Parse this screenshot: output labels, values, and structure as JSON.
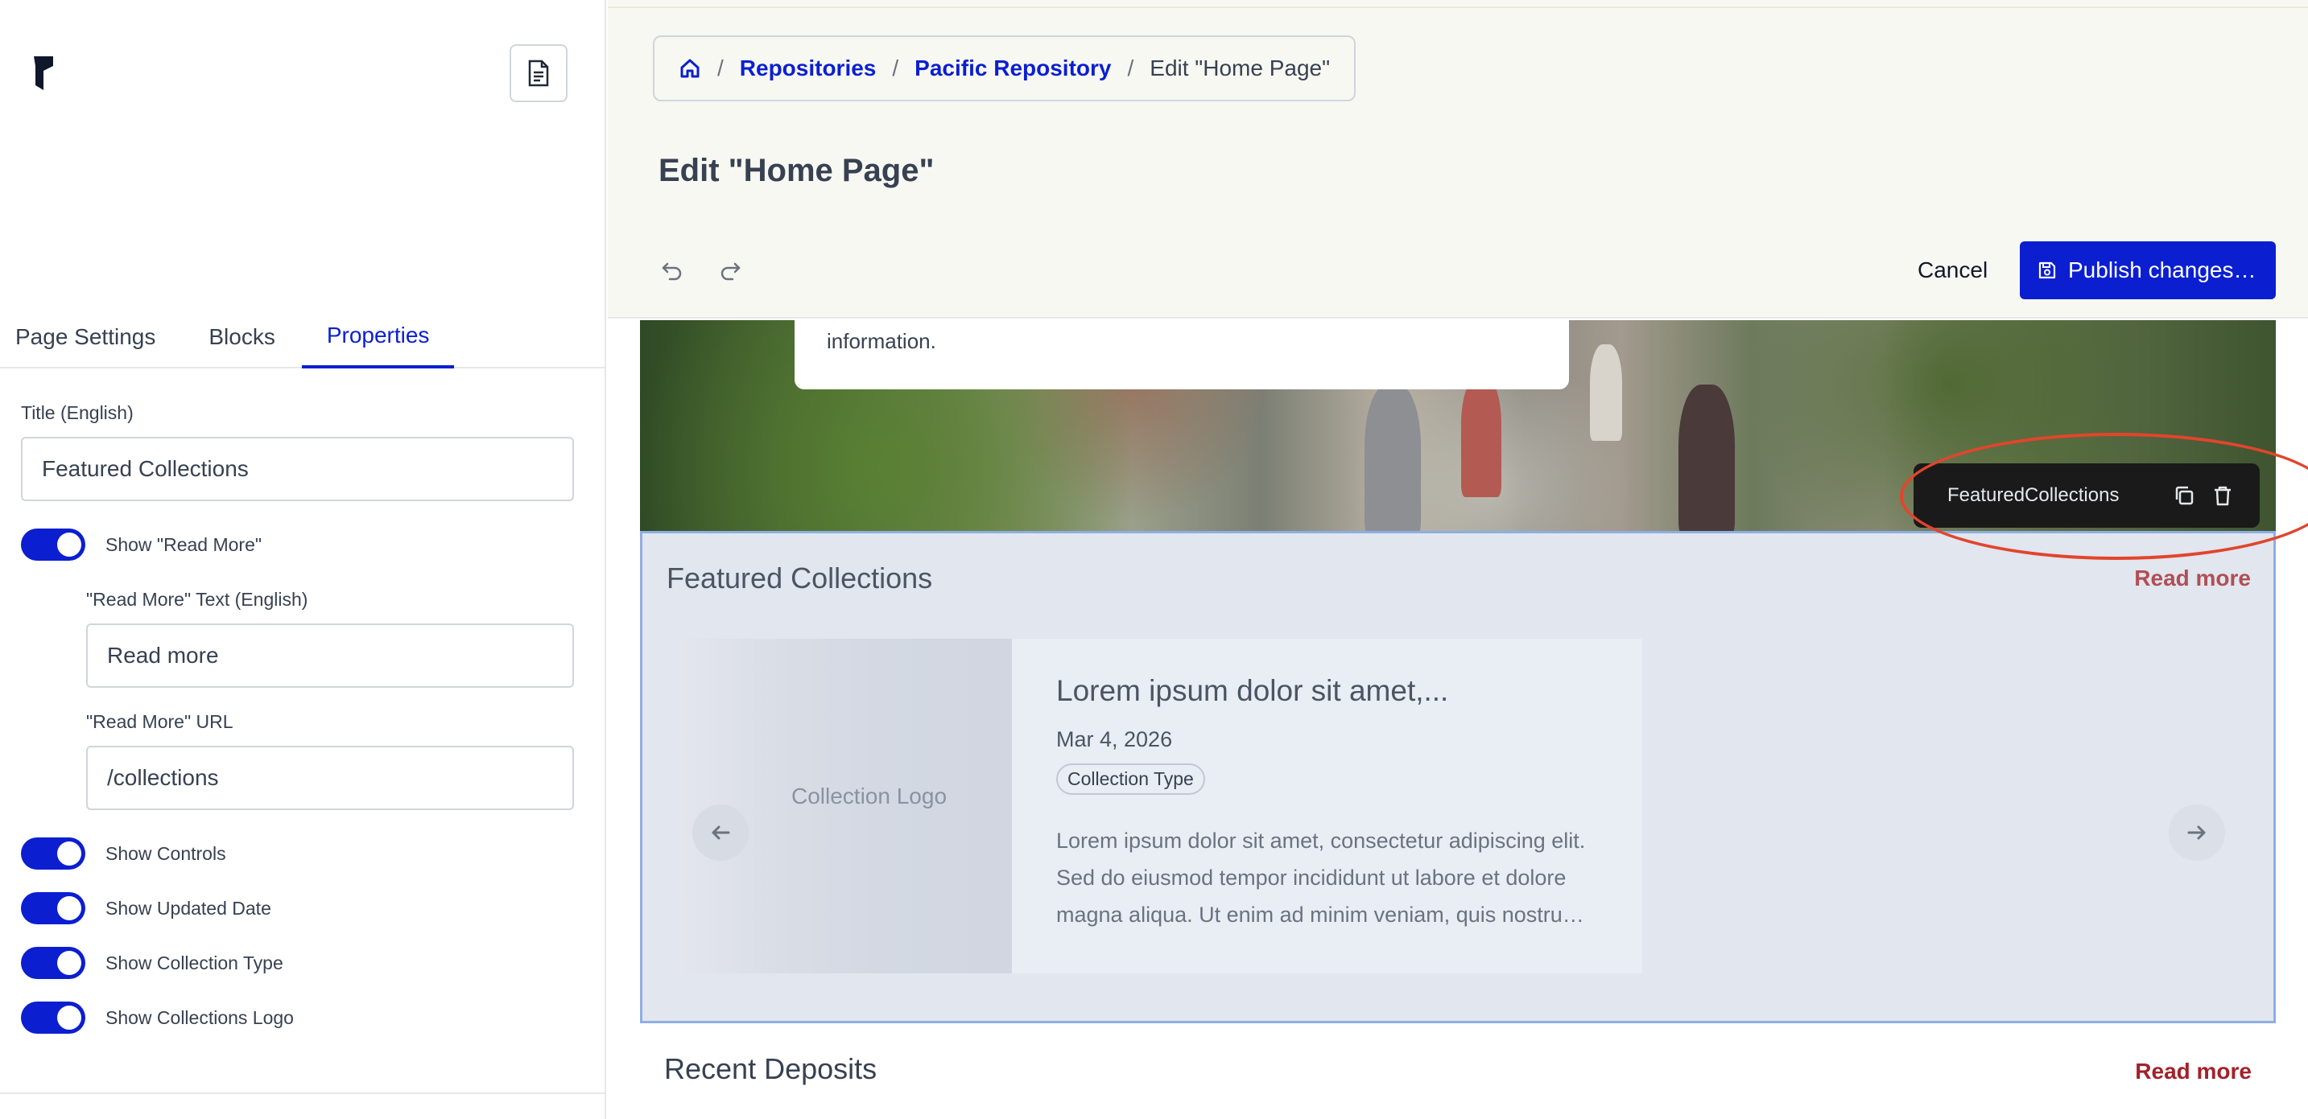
{
  "sidebar": {
    "tabs": [
      {
        "label": "Page Settings"
      },
      {
        "label": "Blocks"
      },
      {
        "label": "Properties"
      }
    ],
    "title_field": {
      "label": "Title (English)",
      "value": "Featured Collections"
    },
    "show_read_more": {
      "label": "Show \"Read More\"",
      "on": true
    },
    "read_more_text": {
      "label": "\"Read More\" Text (English)",
      "value": "Read more"
    },
    "read_more_url": {
      "label": "\"Read More\" URL",
      "value": "/collections"
    },
    "toggles": [
      {
        "label": "Show Controls",
        "on": true
      },
      {
        "label": "Show Updated Date",
        "on": true
      },
      {
        "label": "Show Collection Type",
        "on": true
      },
      {
        "label": "Show Collections Logo",
        "on": true
      }
    ]
  },
  "header": {
    "breadcrumb": {
      "items": [
        "Repositories",
        "Pacific Repository"
      ],
      "current": "Edit \"Home Page\""
    },
    "title": "Edit \"Home Page\"",
    "cancel_label": "Cancel",
    "publish_label": "Publish changes…"
  },
  "canvas": {
    "hero_card_text": "information.",
    "block_toolbar_name": "FeaturedCollections",
    "featured": {
      "title": "Featured Collections",
      "read_more": "Read more",
      "card": {
        "logo_alt": "Collection Logo",
        "title": "Lorem ipsum dolor sit amet,...",
        "date": "Mar 4, 2026",
        "type": "Collection Type",
        "description": "Lorem ipsum dolor sit amet, consectetur adipiscing elit. Sed do eiusmod tempor incididunt ut labore et dolore magna aliqua. Ut enim ad minim veniam, quis nostru…"
      }
    },
    "recent": {
      "title": "Recent Deposits",
      "read_more": "Read more"
    }
  },
  "colors": {
    "accent": "#0b1fd1",
    "read_more": "#a3212a",
    "annotation": "#e2452c"
  },
  "icons": [
    "logo-icon",
    "document-icon",
    "home-icon",
    "undo-icon",
    "redo-icon",
    "save-icon",
    "arrow-left-icon",
    "arrow-right-icon",
    "copy-icon",
    "trash-icon"
  ]
}
